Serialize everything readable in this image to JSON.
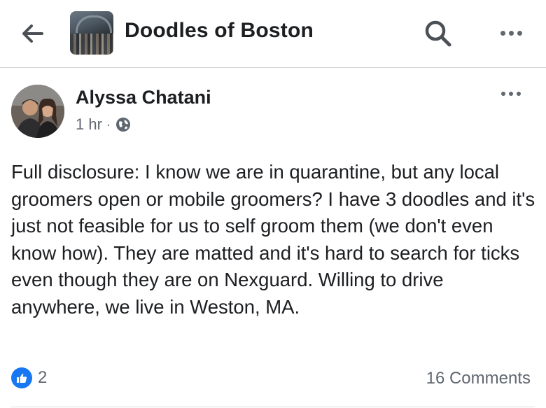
{
  "header": {
    "back_icon": "arrow-left-icon",
    "group_name": "Doodles of Boston",
    "search_icon": "search-icon",
    "more_icon": "more-horizontal-icon"
  },
  "post": {
    "author": "Alyssa Chatani",
    "time": "1 hr",
    "separator": "·",
    "privacy_icon": "globe-icon",
    "text": "Full disclosure: I know we are in quarantine, but any local groomers open or mobile groomers? I have 3 doodles and it's just not feasible for us to self groom them (we don't even know how). They are matted and it's hard to search for ticks even though they are on Nexguard. Willing to drive anywhere, we live in Weston, MA.",
    "reaction_icon": "like-icon",
    "reaction_count": "2",
    "comments": "16 Comments"
  },
  "colors": {
    "accent": "#1877f2",
    "text": "#1c1e21",
    "secondary_text": "#606770"
  }
}
